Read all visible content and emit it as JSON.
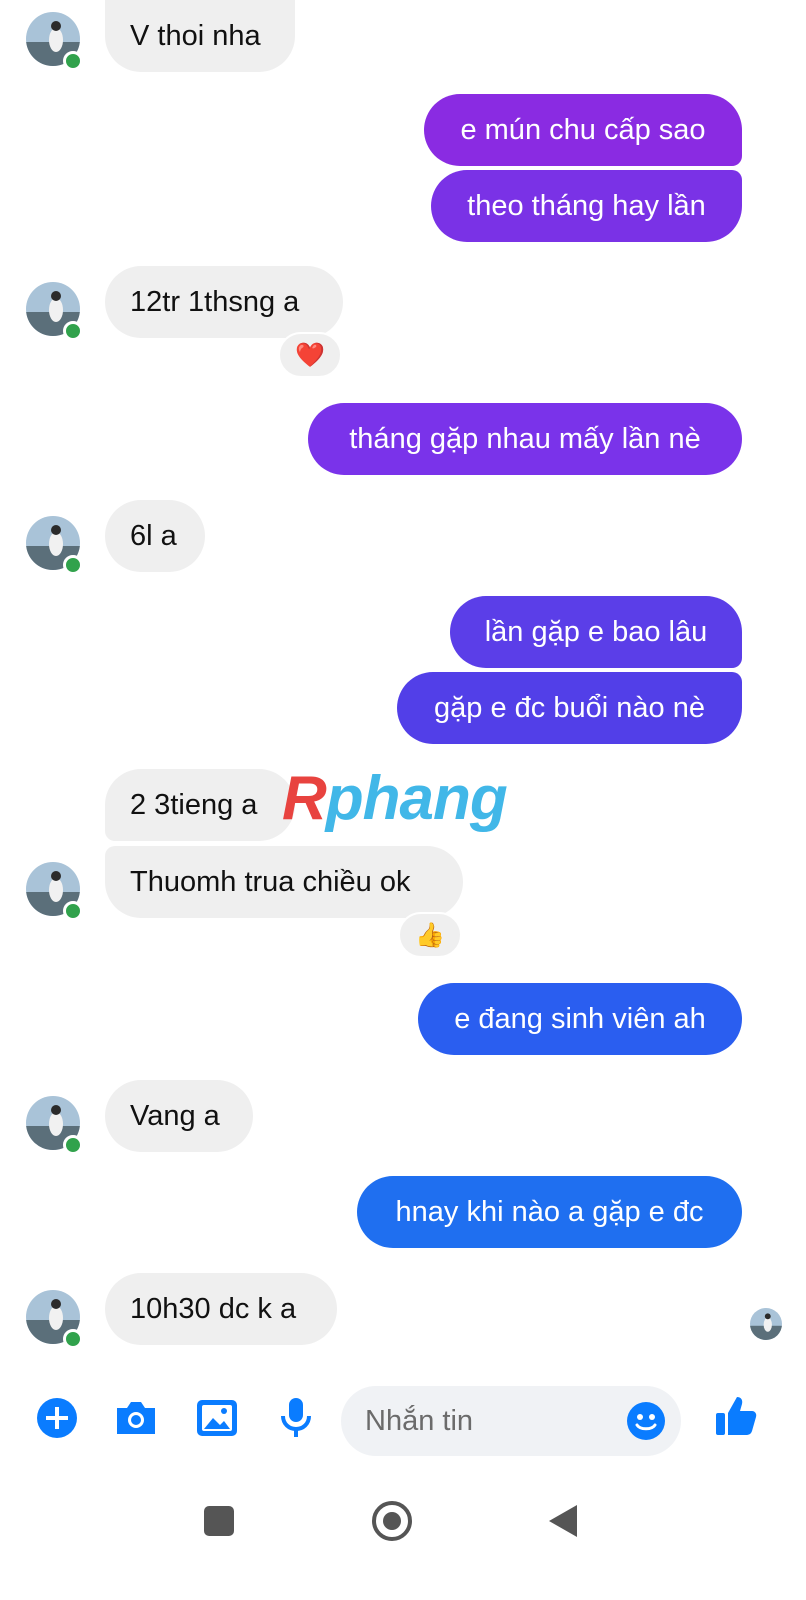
{
  "messages": [
    {
      "text": "V thoi nha"
    },
    {
      "text": "e mún chu cấp sao"
    },
    {
      "text": "theo tháng hay lần"
    },
    {
      "text": "12tr 1thsng a"
    },
    {
      "text": "tháng gặp nhau mấy lần nè"
    },
    {
      "text": "6l a"
    },
    {
      "text": "lần gặp e bao lâu"
    },
    {
      "text": "gặp e đc buổi nào nè"
    },
    {
      "text": "2 3tieng a"
    },
    {
      "text": "Thuomh trua chiều ok"
    },
    {
      "text": "e đang sinh viên ah"
    },
    {
      "text": "Vang a"
    },
    {
      "text": "hnay khi nào a gặp e đc"
    },
    {
      "text": "10h30 dc k a"
    }
  ],
  "reactions": {
    "heart": "❤️",
    "thumbs": "👍"
  },
  "watermark": {
    "first": "R",
    "rest": "phang"
  },
  "composer": {
    "placeholder": "Nhắn tin"
  },
  "colors": {
    "out_purple": "#8a2be2",
    "out_violet": "#5b3ee8",
    "out_blue": "#1f6ff0",
    "incoming": "#efefef",
    "accent": "#0a7cff",
    "online": "#31a24c"
  },
  "icons": [
    "plus-icon",
    "camera-icon",
    "image-icon",
    "mic-icon",
    "emoji-icon",
    "like-icon",
    "square-nav-icon",
    "home-nav-icon",
    "back-nav-icon"
  ]
}
